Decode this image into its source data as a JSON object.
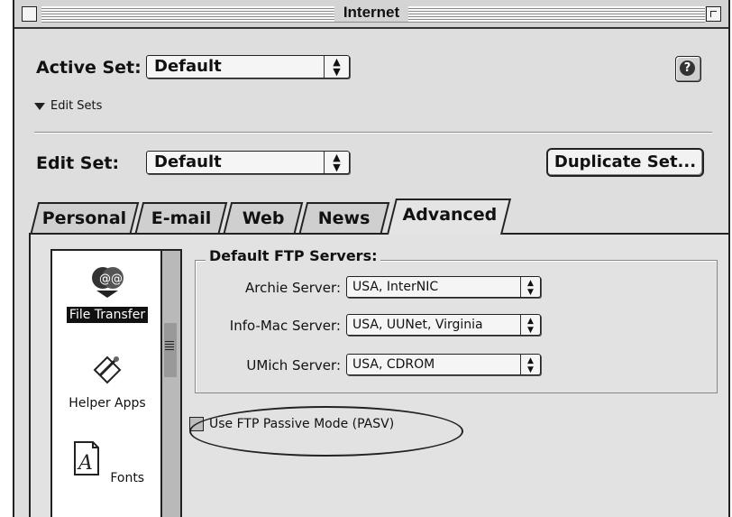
{
  "window": {
    "title": "Internet"
  },
  "active_set": {
    "label": "Active Set:",
    "value": "Default"
  },
  "disclosure": {
    "label": "Edit Sets"
  },
  "edit_set": {
    "label": "Edit Set:",
    "value": "Default"
  },
  "duplicate_button": {
    "label": "Duplicate Set..."
  },
  "help_button": {
    "label": "?"
  },
  "tabs": [
    {
      "label": "Personal"
    },
    {
      "label": "E-mail"
    },
    {
      "label": "Web"
    },
    {
      "label": "News"
    },
    {
      "label": "Advanced"
    }
  ],
  "sidebar": {
    "items": [
      {
        "label": "File Transfer",
        "icon": "file-transfer-icon",
        "selected": true
      },
      {
        "label": "Helper Apps",
        "icon": "helper-apps-icon",
        "selected": false
      },
      {
        "label": "Fonts",
        "icon": "fonts-icon",
        "selected": false
      }
    ]
  },
  "ftp_group": {
    "title": "Default FTP Servers:",
    "rows": [
      {
        "label": "Archie Server:",
        "value": "USA, InterNIC"
      },
      {
        "label": "Info-Mac Server:",
        "value": "USA, UUNet, Virginia"
      },
      {
        "label": "UMich Server:",
        "value": "USA, CDROM"
      }
    ]
  },
  "passive_mode": {
    "label": "Use FTP Passive Mode (PASV)",
    "checked": false
  }
}
